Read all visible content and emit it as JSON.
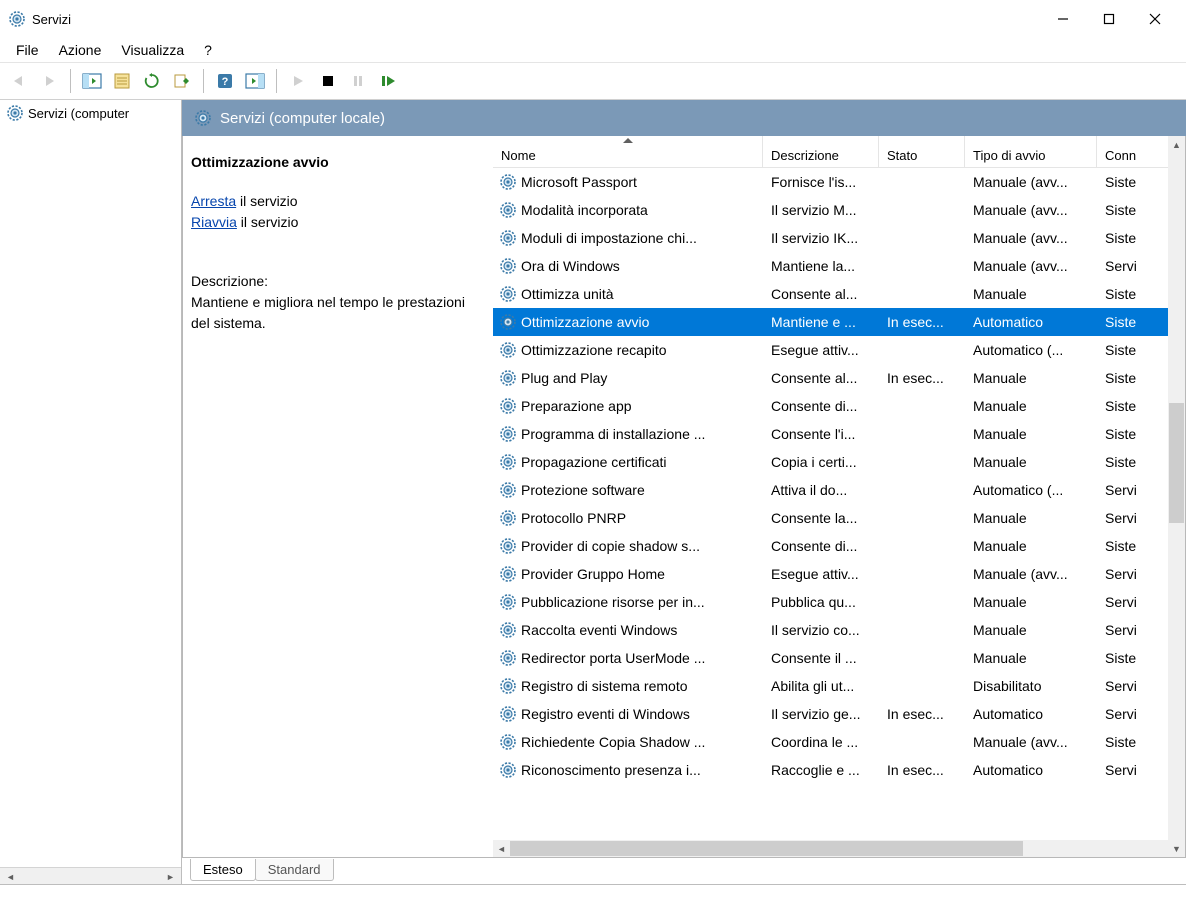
{
  "window": {
    "title": "Servizi"
  },
  "menu": {
    "file": "File",
    "action": "Azione",
    "view": "Visualizza",
    "help": "?"
  },
  "tree": {
    "root": "Servizi (computer"
  },
  "paneHeader": "Servizi (computer locale)",
  "detail": {
    "title": "Ottimizzazione avvio",
    "stopLink": "Arresta",
    "stopAfter": " il servizio",
    "restartLink": "Riavvia",
    "restartAfter": " il servizio",
    "descLabel": "Descrizione:",
    "descText": "Mantiene e migliora nel tempo le prestazioni del sistema."
  },
  "columns": {
    "name": "Nome",
    "desc": "Descrizione",
    "state": "Stato",
    "start": "Tipo di avvio",
    "logon": "Conn"
  },
  "tabs": {
    "extended": "Esteso",
    "standard": "Standard"
  },
  "rows": [
    {
      "name": "Microsoft Passport",
      "desc": "Fornisce l'is...",
      "state": "",
      "start": "Manuale (avv...",
      "logon": "Siste"
    },
    {
      "name": "Modalità incorporata",
      "desc": "Il servizio M...",
      "state": "",
      "start": "Manuale (avv...",
      "logon": "Siste"
    },
    {
      "name": "Moduli di impostazione chi...",
      "desc": "Il servizio IK...",
      "state": "",
      "start": "Manuale (avv...",
      "logon": "Siste"
    },
    {
      "name": "Ora di Windows",
      "desc": "Mantiene la...",
      "state": "",
      "start": "Manuale (avv...",
      "logon": "Servi"
    },
    {
      "name": "Ottimizza unità",
      "desc": "Consente al...",
      "state": "",
      "start": "Manuale",
      "logon": "Siste"
    },
    {
      "name": "Ottimizzazione avvio",
      "desc": "Mantiene e ...",
      "state": "In esec...",
      "start": "Automatico",
      "logon": "Siste",
      "selected": true
    },
    {
      "name": "Ottimizzazione recapito",
      "desc": "Esegue attiv...",
      "state": "",
      "start": "Automatico (...",
      "logon": "Siste"
    },
    {
      "name": "Plug and Play",
      "desc": "Consente al...",
      "state": "In esec...",
      "start": "Manuale",
      "logon": "Siste"
    },
    {
      "name": "Preparazione app",
      "desc": "Consente di...",
      "state": "",
      "start": "Manuale",
      "logon": "Siste"
    },
    {
      "name": "Programma di installazione ...",
      "desc": "Consente l'i...",
      "state": "",
      "start": "Manuale",
      "logon": "Siste"
    },
    {
      "name": "Propagazione certificati",
      "desc": "Copia i certi...",
      "state": "",
      "start": "Manuale",
      "logon": "Siste"
    },
    {
      "name": "Protezione software",
      "desc": "Attiva il do...",
      "state": "",
      "start": "Automatico (...",
      "logon": "Servi"
    },
    {
      "name": "Protocollo PNRP",
      "desc": "Consente la...",
      "state": "",
      "start": "Manuale",
      "logon": "Servi"
    },
    {
      "name": "Provider di copie shadow s...",
      "desc": "Consente di...",
      "state": "",
      "start": "Manuale",
      "logon": "Siste"
    },
    {
      "name": "Provider Gruppo Home",
      "desc": "Esegue attiv...",
      "state": "",
      "start": "Manuale (avv...",
      "logon": "Servi"
    },
    {
      "name": "Pubblicazione risorse per in...",
      "desc": "Pubblica qu...",
      "state": "",
      "start": "Manuale",
      "logon": "Servi"
    },
    {
      "name": "Raccolta eventi Windows",
      "desc": "Il servizio co...",
      "state": "",
      "start": "Manuale",
      "logon": "Servi"
    },
    {
      "name": "Redirector porta UserMode ...",
      "desc": "Consente il ...",
      "state": "",
      "start": "Manuale",
      "logon": "Siste"
    },
    {
      "name": "Registro di sistema remoto",
      "desc": "Abilita gli ut...",
      "state": "",
      "start": "Disabilitato",
      "logon": "Servi"
    },
    {
      "name": "Registro eventi di Windows",
      "desc": "Il servizio ge...",
      "state": "In esec...",
      "start": "Automatico",
      "logon": "Servi"
    },
    {
      "name": "Richiedente Copia Shadow ...",
      "desc": "Coordina le ...",
      "state": "",
      "start": "Manuale (avv...",
      "logon": "Siste"
    },
    {
      "name": "Riconoscimento presenza i...",
      "desc": "Raccoglie e ...",
      "state": "In esec...",
      "start": "Automatico",
      "logon": "Servi"
    }
  ]
}
